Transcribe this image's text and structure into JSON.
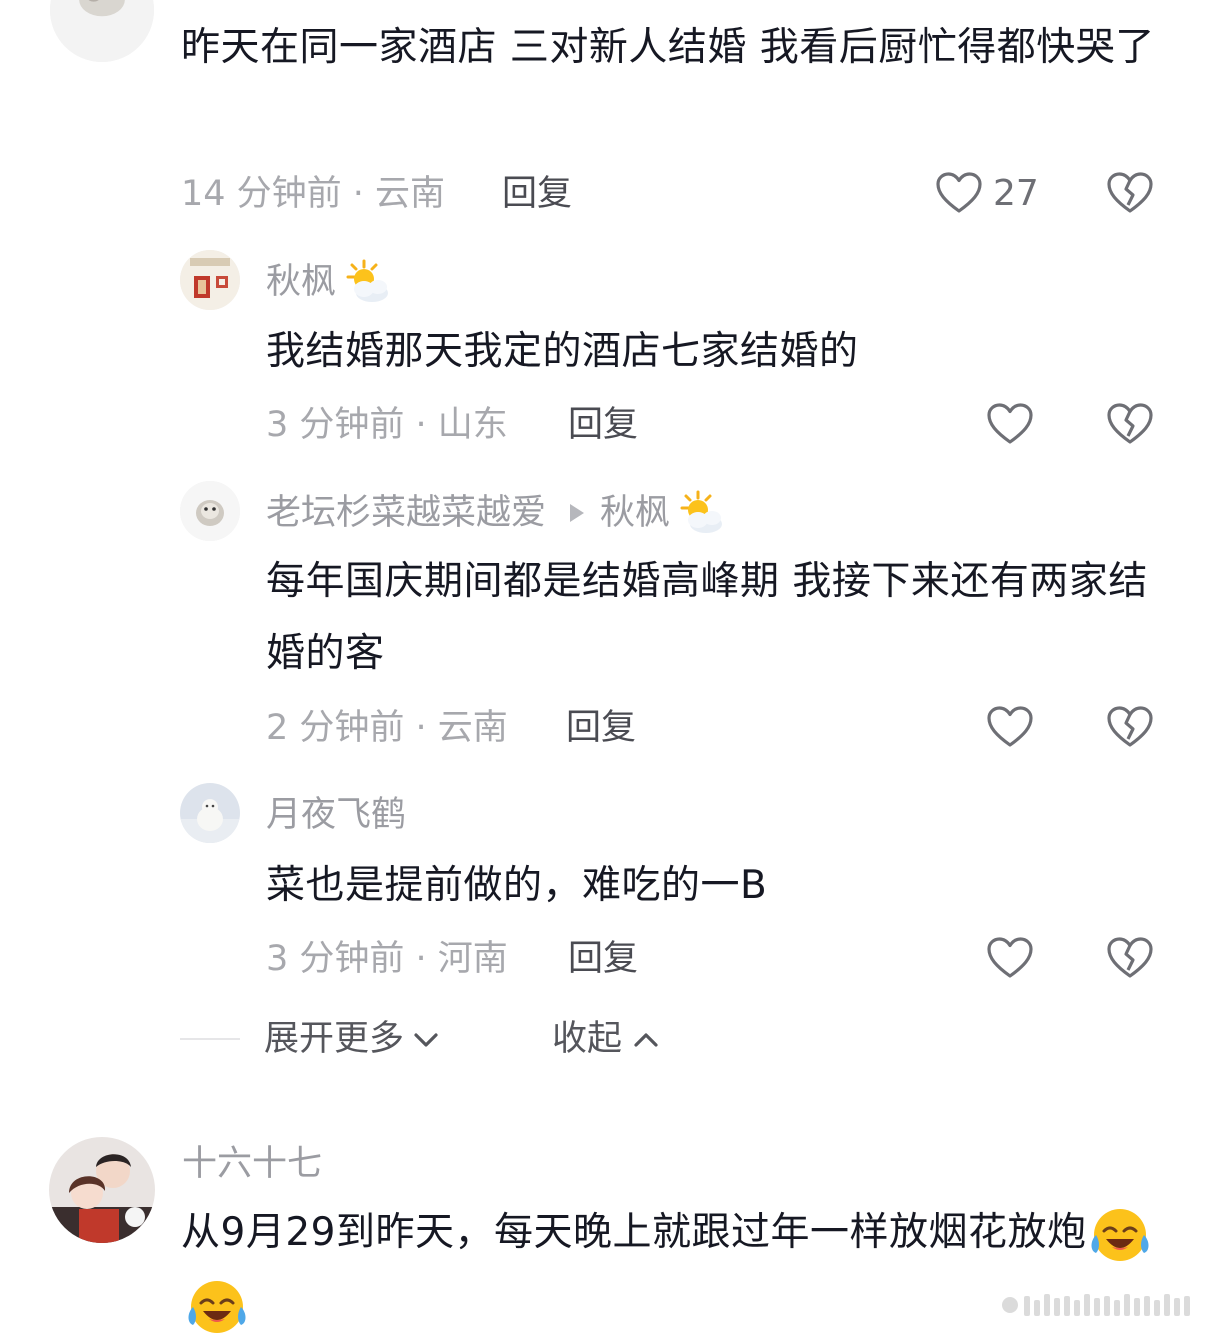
{
  "comment1": {
    "text": "昨天在同一家酒店 三对新人结婚 我看后厨忙得都快哭了",
    "meta": "14 分钟前 · 云南",
    "reply_label": "回复",
    "likes": "27"
  },
  "reply1": {
    "user": "秋枫",
    "user_emoji": "sun-behind-cloud-emoji",
    "text": "我结婚那天我定的酒店七家结婚的",
    "meta": "3 分钟前 · 山东",
    "reply_label": "回复"
  },
  "reply2": {
    "user": "老坛杉菜越菜越爱",
    "reply_to": "秋枫",
    "reply_to_emoji": "sun-behind-cloud-emoji",
    "text": "每年国庆期间都是结婚高峰期 我接下来还有两家结婚的客",
    "meta": "2 分钟前 · 云南",
    "reply_label": "回复"
  },
  "reply3": {
    "user": "月夜飞鹤",
    "text": "菜也是提前做的，难吃的一B",
    "meta": "3 分钟前 · 河南",
    "reply_label": "回复"
  },
  "thread_controls": {
    "expand_label": "展开更多",
    "collapse_label": "收起"
  },
  "comment2": {
    "user": "十六十七",
    "text": "从9月29到昨天，每天晚上就跟过年一样放烟花放炮",
    "trailing_emojis": [
      "laughing-crying-emoji",
      "laughing-crying-emoji"
    ]
  },
  "colors": {
    "text": "#161823",
    "meta": "#a7a8ad",
    "username": "#9b9ca2",
    "icon": "#6e6f75"
  }
}
